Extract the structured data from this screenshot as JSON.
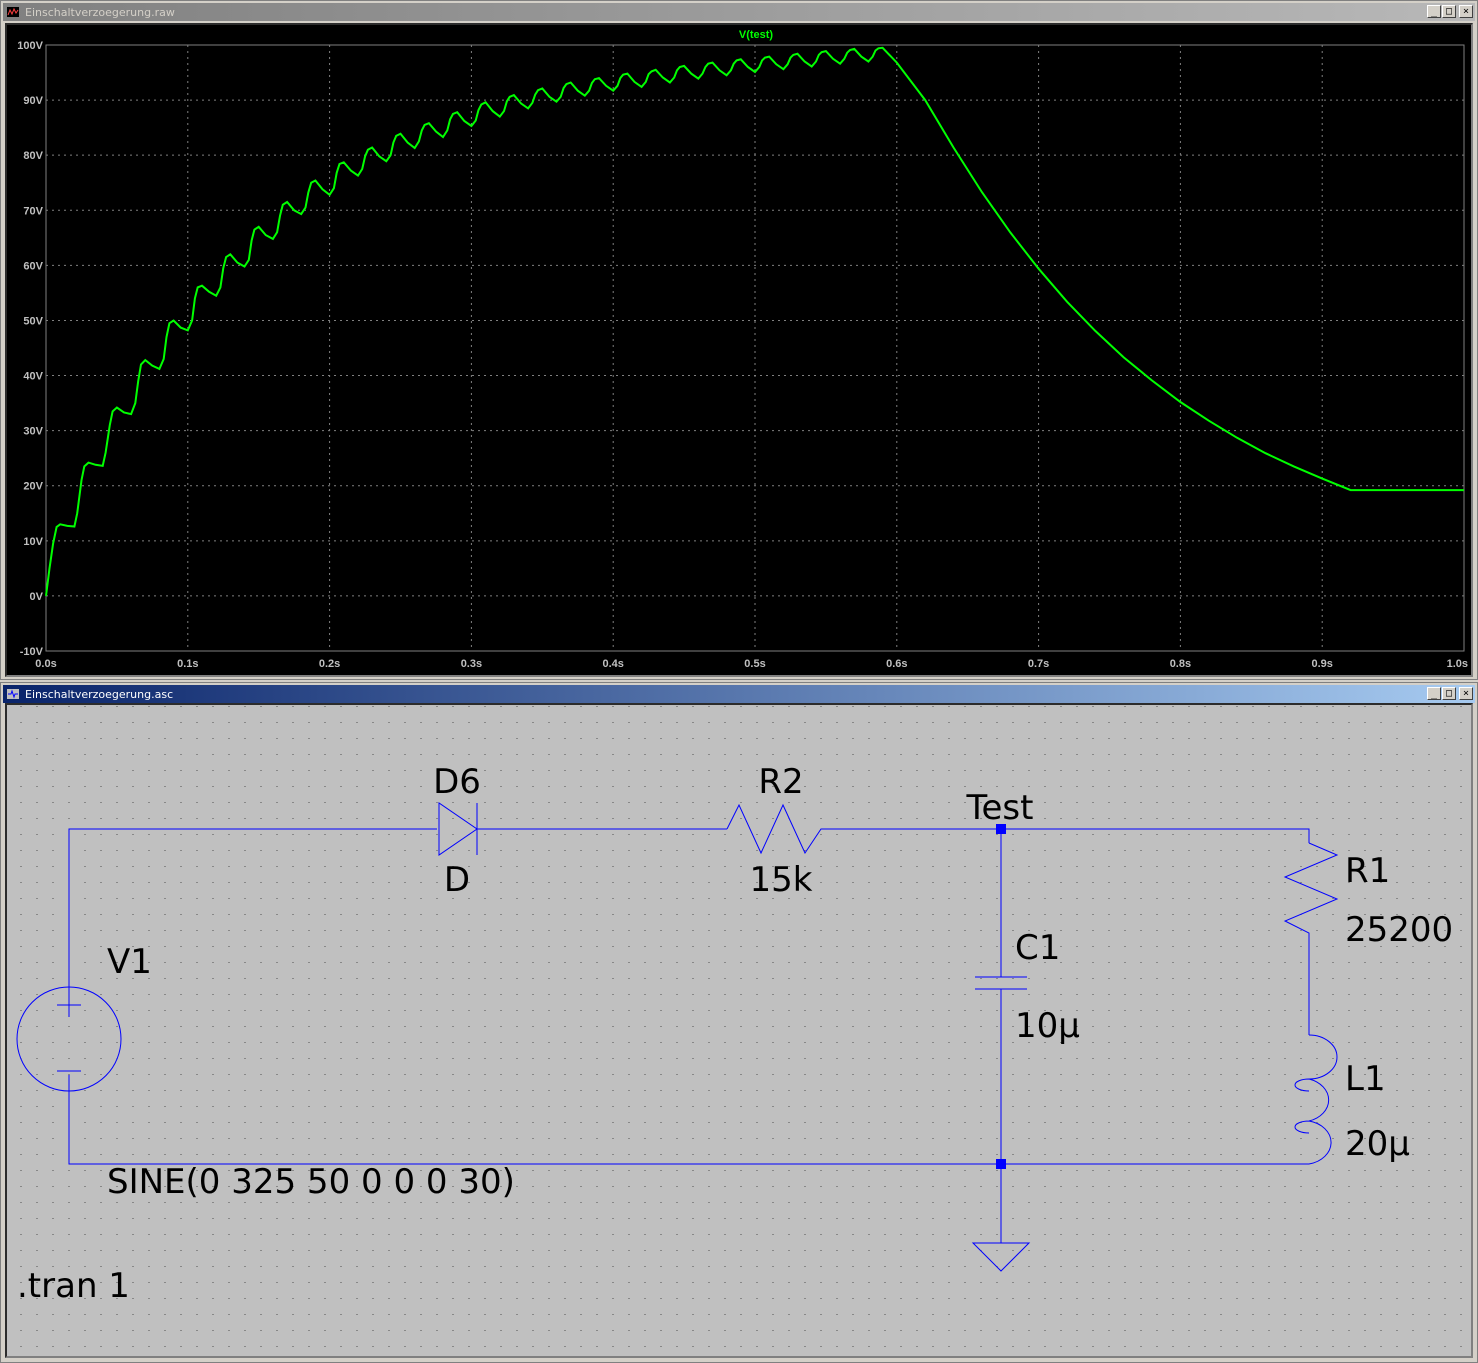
{
  "plot_window": {
    "title": "Einschaltverzoegerung.raw",
    "trace_label": "V(test)",
    "colors": {
      "background": "#000000",
      "grid": "#808080",
      "axis_text": "#c0c0c0",
      "trace": "#00ff00"
    },
    "chart_data": {
      "type": "line",
      "series": [
        {
          "name": "V(test)",
          "x": [
            0.0,
            0.0025,
            0.005,
            0.0075,
            0.01,
            0.015,
            0.02,
            0.022,
            0.025,
            0.027,
            0.03,
            0.035,
            0.04,
            0.042,
            0.045,
            0.047,
            0.05,
            0.055,
            0.06,
            0.063,
            0.065,
            0.067,
            0.07,
            0.075,
            0.08,
            0.083,
            0.085,
            0.087,
            0.09,
            0.095,
            0.1,
            0.103,
            0.105,
            0.107,
            0.11,
            0.115,
            0.12,
            0.123,
            0.125,
            0.127,
            0.13,
            0.135,
            0.14,
            0.143,
            0.145,
            0.147,
            0.15,
            0.155,
            0.16,
            0.163,
            0.165,
            0.167,
            0.17,
            0.175,
            0.18,
            0.183,
            0.185,
            0.187,
            0.19,
            0.195,
            0.2,
            0.203,
            0.205,
            0.207,
            0.21,
            0.215,
            0.22,
            0.223,
            0.225,
            0.227,
            0.23,
            0.235,
            0.24,
            0.243,
            0.245,
            0.247,
            0.25,
            0.255,
            0.26,
            0.263,
            0.265,
            0.267,
            0.27,
            0.275,
            0.28,
            0.283,
            0.285,
            0.287,
            0.29,
            0.295,
            0.3,
            0.303,
            0.305,
            0.307,
            0.31,
            0.315,
            0.32,
            0.323,
            0.325,
            0.327,
            0.33,
            0.335,
            0.34,
            0.343,
            0.345,
            0.347,
            0.35,
            0.355,
            0.36,
            0.363,
            0.365,
            0.367,
            0.37,
            0.375,
            0.38,
            0.383,
            0.385,
            0.387,
            0.39,
            0.395,
            0.4,
            0.403,
            0.405,
            0.407,
            0.41,
            0.415,
            0.42,
            0.423,
            0.425,
            0.427,
            0.43,
            0.435,
            0.44,
            0.443,
            0.445,
            0.447,
            0.45,
            0.455,
            0.46,
            0.463,
            0.465,
            0.467,
            0.47,
            0.475,
            0.48,
            0.483,
            0.485,
            0.487,
            0.49,
            0.495,
            0.5,
            0.503,
            0.505,
            0.507,
            0.51,
            0.515,
            0.52,
            0.523,
            0.525,
            0.527,
            0.53,
            0.535,
            0.54,
            0.543,
            0.545,
            0.547,
            0.55,
            0.555,
            0.56,
            0.563,
            0.565,
            0.567,
            0.57,
            0.575,
            0.58,
            0.583,
            0.585,
            0.587,
            0.59,
            0.6,
            0.62,
            0.64,
            0.66,
            0.68,
            0.7,
            0.72,
            0.74,
            0.76,
            0.78,
            0.8,
            0.82,
            0.84,
            0.86,
            0.88,
            0.9,
            0.92,
            0.94,
            0.96,
            0.98,
            1.0
          ],
          "y": [
            0,
            5,
            9.5,
            12.5,
            13,
            12.7,
            12.6,
            15,
            21,
            23.5,
            24.2,
            23.8,
            23.6,
            26,
            31,
            33.5,
            34.2,
            33.3,
            33,
            35,
            39,
            42,
            42.8,
            41.8,
            41.2,
            43,
            47,
            49.5,
            50,
            48.7,
            48.2,
            50,
            54,
            56,
            56.3,
            55.2,
            54.5,
            56,
            59.5,
            61.5,
            62,
            60.5,
            59.8,
            61,
            64.5,
            66.5,
            67,
            65.5,
            64.8,
            66,
            69,
            71,
            71.5,
            70,
            69.3,
            70.5,
            73.2,
            75,
            75.4,
            73.8,
            72.8,
            74,
            76.8,
            78.4,
            78.7,
            77.2,
            76.3,
            77.5,
            79.8,
            81,
            81.4,
            79.8,
            78.9,
            80,
            82.3,
            83.5,
            83.9,
            82.3,
            81.3,
            82.5,
            84.5,
            85.5,
            85.8,
            84.3,
            83.3,
            84.5,
            86.5,
            87.5,
            87.8,
            86.2,
            85.3,
            86.3,
            88.2,
            89.2,
            89.6,
            88,
            87,
            88,
            89.8,
            90.6,
            90.9,
            89.4,
            88.5,
            89.5,
            91,
            91.8,
            92.1,
            90.6,
            89.7,
            90.6,
            92.2,
            92.9,
            93.2,
            91.7,
            90.8,
            91.7,
            93.1,
            93.8,
            94,
            92.6,
            91.7,
            92.6,
            94,
            94.6,
            94.8,
            93.3,
            92.4,
            93.3,
            94.7,
            95.2,
            95.5,
            94.1,
            93.2,
            94.1,
            95.4,
            96,
            96.2,
            94.8,
            93.9,
            94.8,
            96,
            96.6,
            96.8,
            95.4,
            94.5,
            95.4,
            96.6,
            97.2,
            97.4,
            96,
            95.1,
            96,
            97.2,
            97.7,
            97.9,
            96.5,
            95.6,
            96.5,
            97.7,
            98.2,
            98.4,
            97,
            96.1,
            97,
            98.2,
            98.7,
            98.9,
            97.5,
            96.6,
            97.5,
            98.6,
            99.1,
            99.3,
            97.9,
            97,
            97.9,
            99,
            99.4,
            99.5,
            96.8,
            90,
            81.4,
            73.3,
            66,
            59.4,
            53.4,
            48.1,
            43.3,
            39.1,
            35.2,
            31.8,
            28.7,
            25.9,
            23.5,
            21.3,
            19.2,
            19.2,
            19.2,
            19.2,
            19.2
          ]
        }
      ],
      "title": "V(test)",
      "xlabel": "",
      "ylabel": "",
      "xlim": [
        0,
        1
      ],
      "ylim": [
        -10,
        100
      ],
      "x_ticks": [
        0,
        0.1,
        0.2,
        0.3,
        0.4,
        0.5,
        0.6,
        0.7,
        0.8,
        0.9,
        1.0
      ],
      "x_tick_labels": [
        "0.0s",
        "0.1s",
        "0.2s",
        "0.3s",
        "0.4s",
        "0.5s",
        "0.6s",
        "0.7s",
        "0.8s",
        "0.9s",
        "1.0s"
      ],
      "y_ticks": [
        100,
        90,
        80,
        70,
        60,
        50,
        40,
        30,
        20,
        10,
        0,
        -10
      ],
      "y_tick_labels": [
        "100V",
        "90V",
        "80V",
        "70V",
        "60V",
        "50V",
        "40V",
        "30V",
        "20V",
        "10V",
        "0V",
        "-10V"
      ],
      "grid": true,
      "legend": "top-center"
    }
  },
  "schematic_window": {
    "title": "Einschaltverzoegerung.asc",
    "colors": {
      "background": "#c0c0c0",
      "wire": "#0000ff",
      "text": "#000000",
      "dot": "#000000"
    },
    "components": {
      "diode": {
        "name": "D6",
        "value": "D"
      },
      "resistor2": {
        "name": "R2",
        "value": "15k"
      },
      "resistor1": {
        "name": "R1",
        "value": "25200"
      },
      "capacitor": {
        "name": "C1",
        "value": "10µ"
      },
      "inductor": {
        "name": "L1",
        "value": "20µ"
      },
      "source": {
        "name": "V1",
        "value": "SINE(0 325 50 0 0 0 30)"
      }
    },
    "net_label": "Test",
    "directive": ".tran 1"
  },
  "window_buttons": {
    "minimize": "_",
    "maximize": "□",
    "close": "×"
  }
}
